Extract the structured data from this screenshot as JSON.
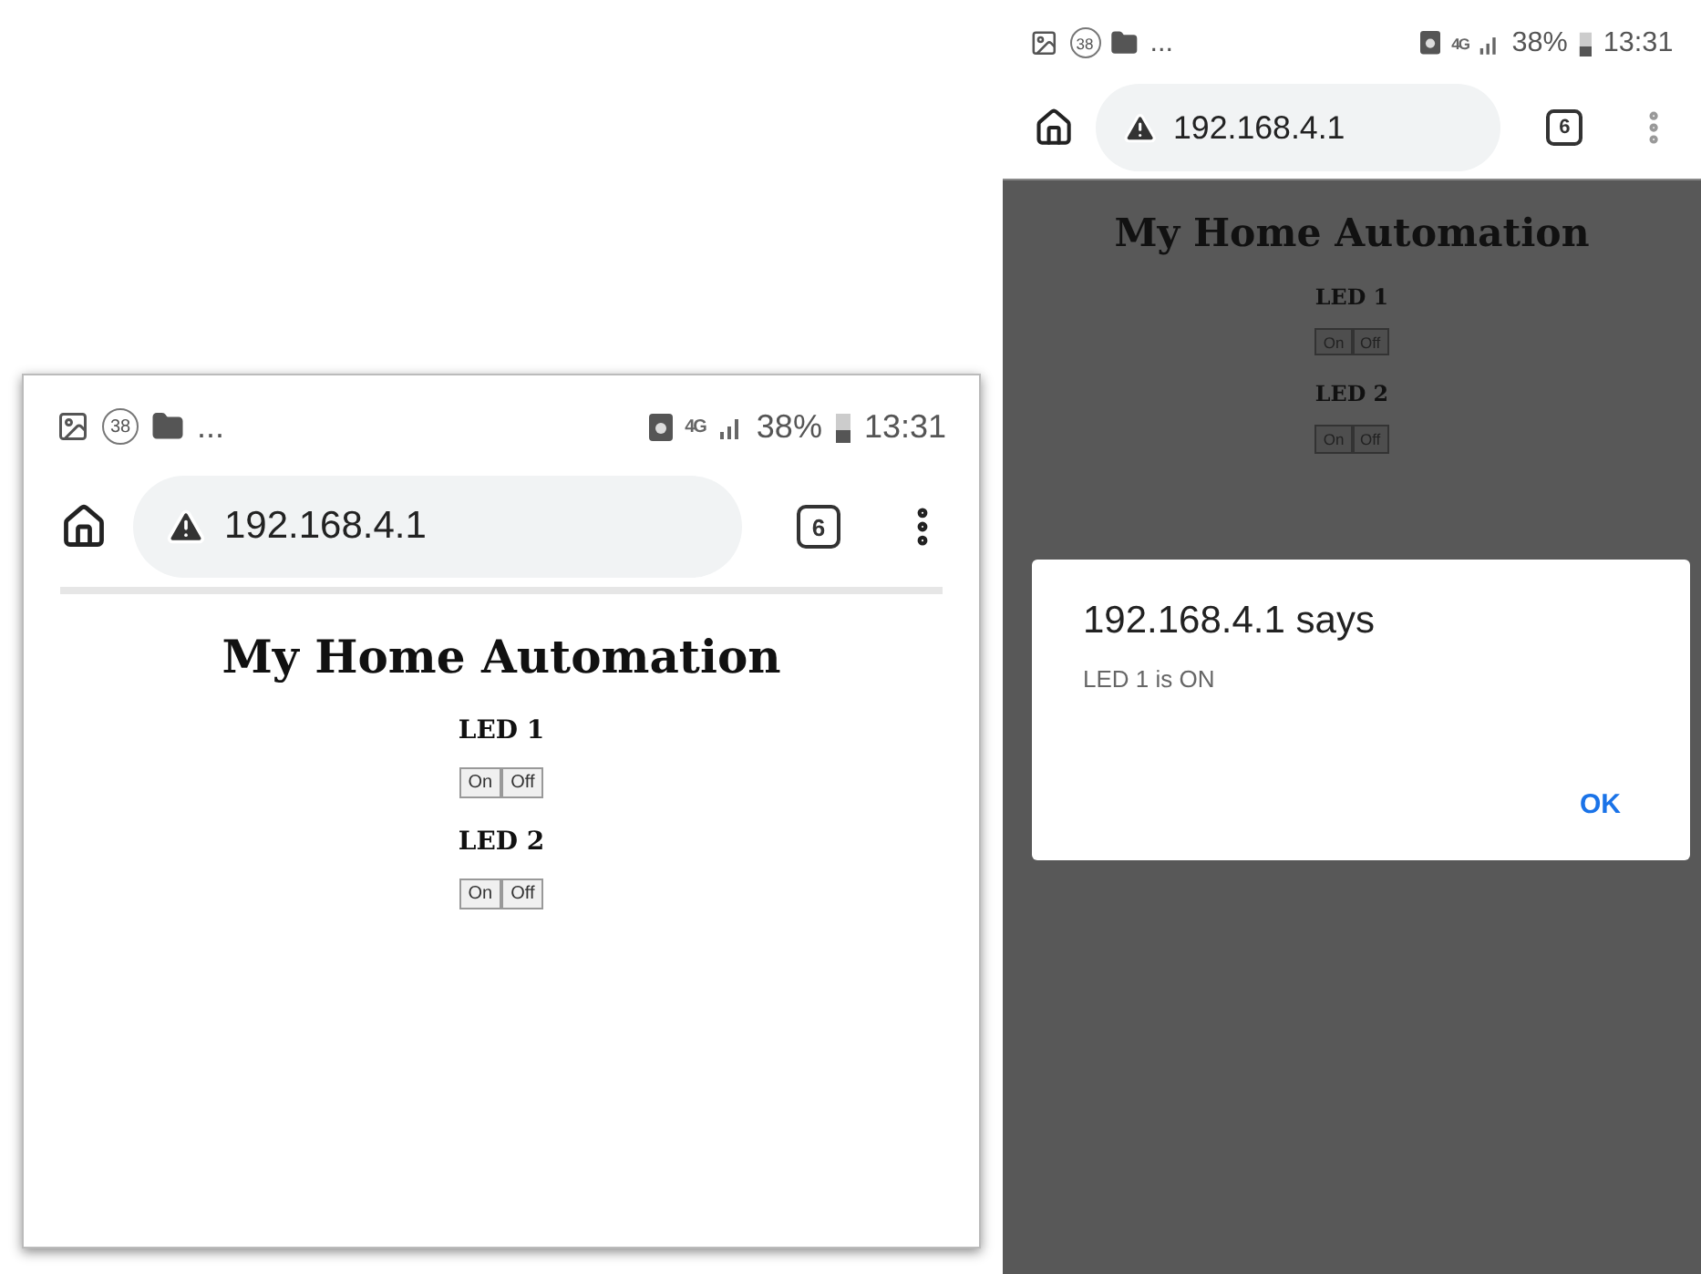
{
  "screens": [
    {
      "dimmed": false,
      "status_bar": {
        "notification_count": "38",
        "more": "...",
        "network": "4G",
        "battery": "38%",
        "time": "13:31"
      },
      "address_bar": {
        "url": "192.168.4.1",
        "tab_count": "6"
      },
      "page": {
        "title": "My Home Automation",
        "devices": [
          {
            "name": "LED 1",
            "buttons": [
              "On",
              "Off"
            ]
          },
          {
            "name": "LED 2",
            "buttons": [
              "On",
              "Off"
            ]
          }
        ]
      }
    },
    {
      "dimmed": true,
      "status_bar": {
        "notification_count": "38",
        "more": "...",
        "network": "4G",
        "battery": "38%",
        "time": "13:31"
      },
      "address_bar": {
        "url": "192.168.4.1",
        "tab_count": "6"
      },
      "page": {
        "title": "My Home Automation",
        "devices": [
          {
            "name": "LED 1",
            "buttons": [
              "On",
              "Off"
            ]
          },
          {
            "name": "LED 2",
            "buttons": [
              "On",
              "Off"
            ]
          }
        ]
      },
      "dialog": {
        "title": "192.168.4.1 says",
        "message": "LED 1 is ON",
        "button": "OK"
      }
    }
  ]
}
